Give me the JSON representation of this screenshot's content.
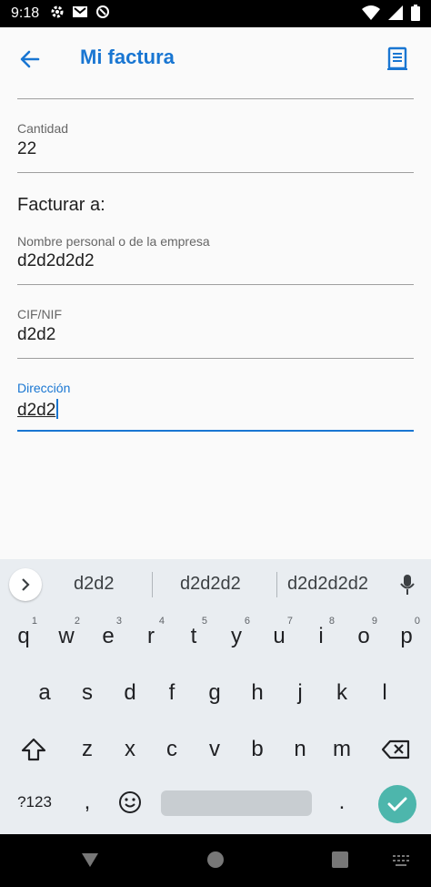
{
  "status_bar": {
    "time": "9:18",
    "left_icons": [
      "gear-icon",
      "mail-icon",
      "sync-icon"
    ],
    "right_icons": [
      "wifi-icon",
      "signal-icon",
      "battery-icon"
    ]
  },
  "app_bar": {
    "title": "Mi factura",
    "accent_color": "#1976d2"
  },
  "form": {
    "quantity": {
      "label": "Cantidad",
      "value": "22"
    },
    "section_title": "Facturar a:",
    "name": {
      "label": "Nombre personal o de la empresa",
      "value": "d2d2d2d2"
    },
    "cif": {
      "label": "CIF/NIF",
      "value": "d2d2"
    },
    "address": {
      "label": "Dirección",
      "value": "d2d2"
    }
  },
  "keyboard": {
    "suggestions": [
      "d2d2",
      "d2d2d2",
      "d2d2d2d2"
    ],
    "row1": [
      {
        "k": "q",
        "h": "1"
      },
      {
        "k": "w",
        "h": "2"
      },
      {
        "k": "e",
        "h": "3"
      },
      {
        "k": "r",
        "h": "4"
      },
      {
        "k": "t",
        "h": "5"
      },
      {
        "k": "y",
        "h": "6"
      },
      {
        "k": "u",
        "h": "7"
      },
      {
        "k": "i",
        "h": "8"
      },
      {
        "k": "o",
        "h": "9"
      },
      {
        "k": "p",
        "h": "0"
      }
    ],
    "row2": [
      "a",
      "s",
      "d",
      "f",
      "g",
      "h",
      "j",
      "k",
      "l"
    ],
    "row3": [
      "z",
      "x",
      "c",
      "v",
      "b",
      "n",
      "m"
    ],
    "symbols_label": "?123",
    "comma": ",",
    "period": "."
  }
}
